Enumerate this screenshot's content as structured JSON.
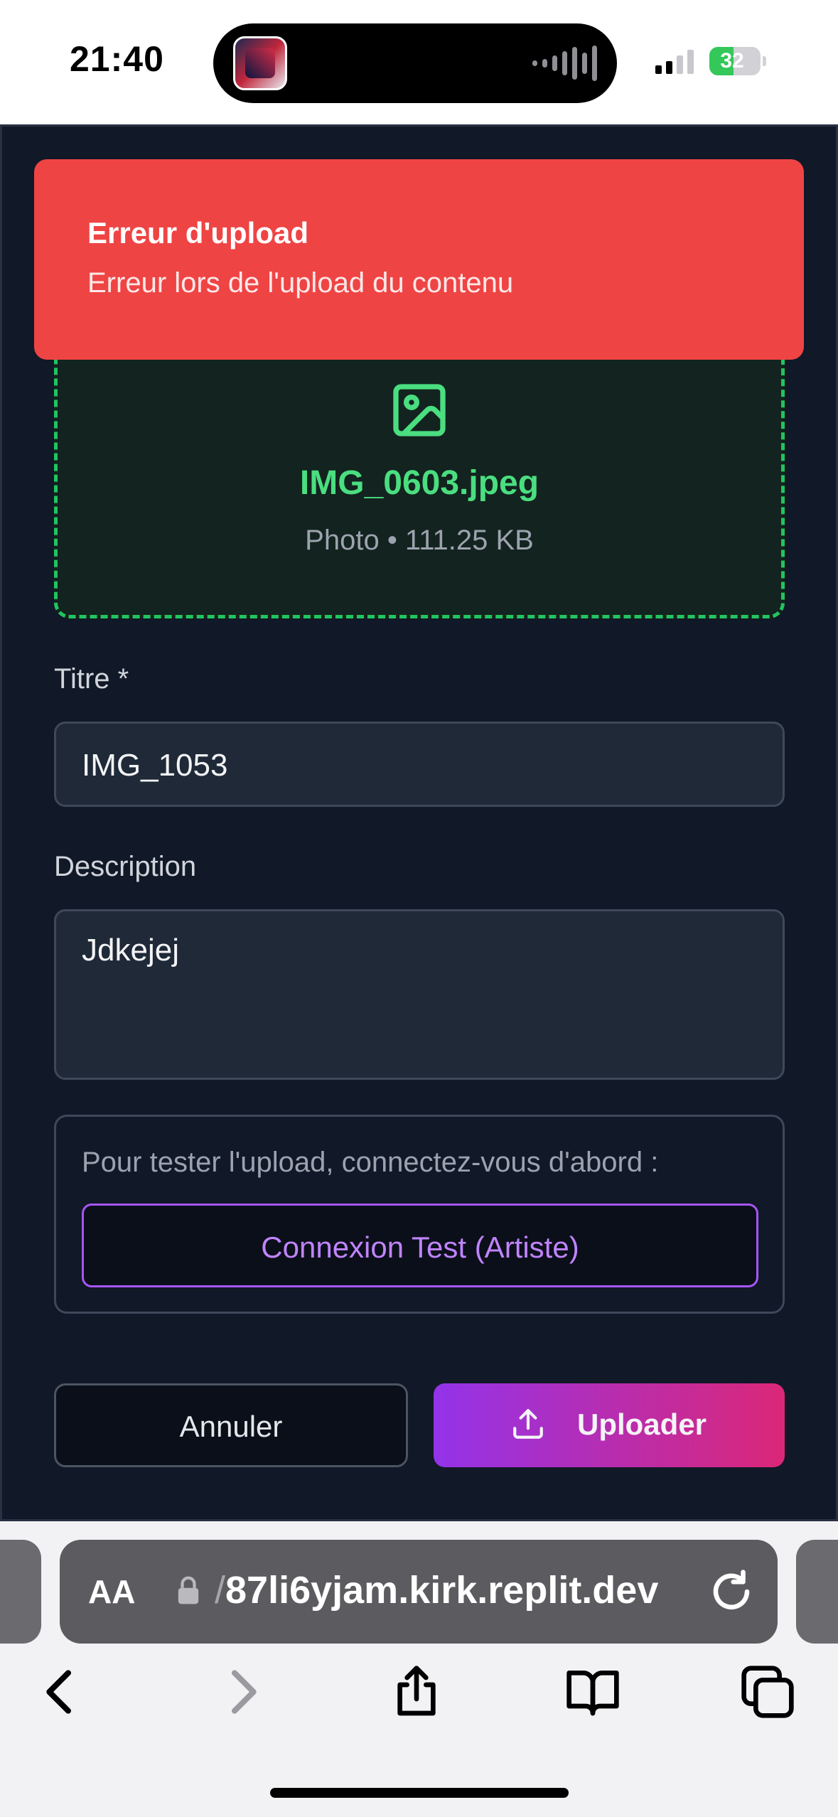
{
  "status_bar": {
    "time": "21:40",
    "battery": "32"
  },
  "toast": {
    "title": "Erreur d'upload",
    "message": "Erreur lors de l'upload du contenu",
    "color": "#ef4444"
  },
  "dropzone": {
    "icon": "image-icon",
    "file_name": "IMG_0603.jpeg",
    "file_meta": "Photo • 111.25 KB",
    "accent": "#22c55e"
  },
  "form": {
    "title_label": "Titre *",
    "title_value": "IMG_1053",
    "description_label": "Description",
    "description_value": "Jdkejej"
  },
  "login": {
    "hint": "Pour tester l'upload, connectez-vous d'abord :",
    "button_label": "Connexion Test (Artiste)"
  },
  "actions": {
    "cancel_label": "Annuler",
    "upload_label": "Uploader"
  },
  "browser": {
    "aa_label": "AA",
    "url_prefix": "/",
    "url": "87li6yjam.kirk.replit.dev"
  }
}
